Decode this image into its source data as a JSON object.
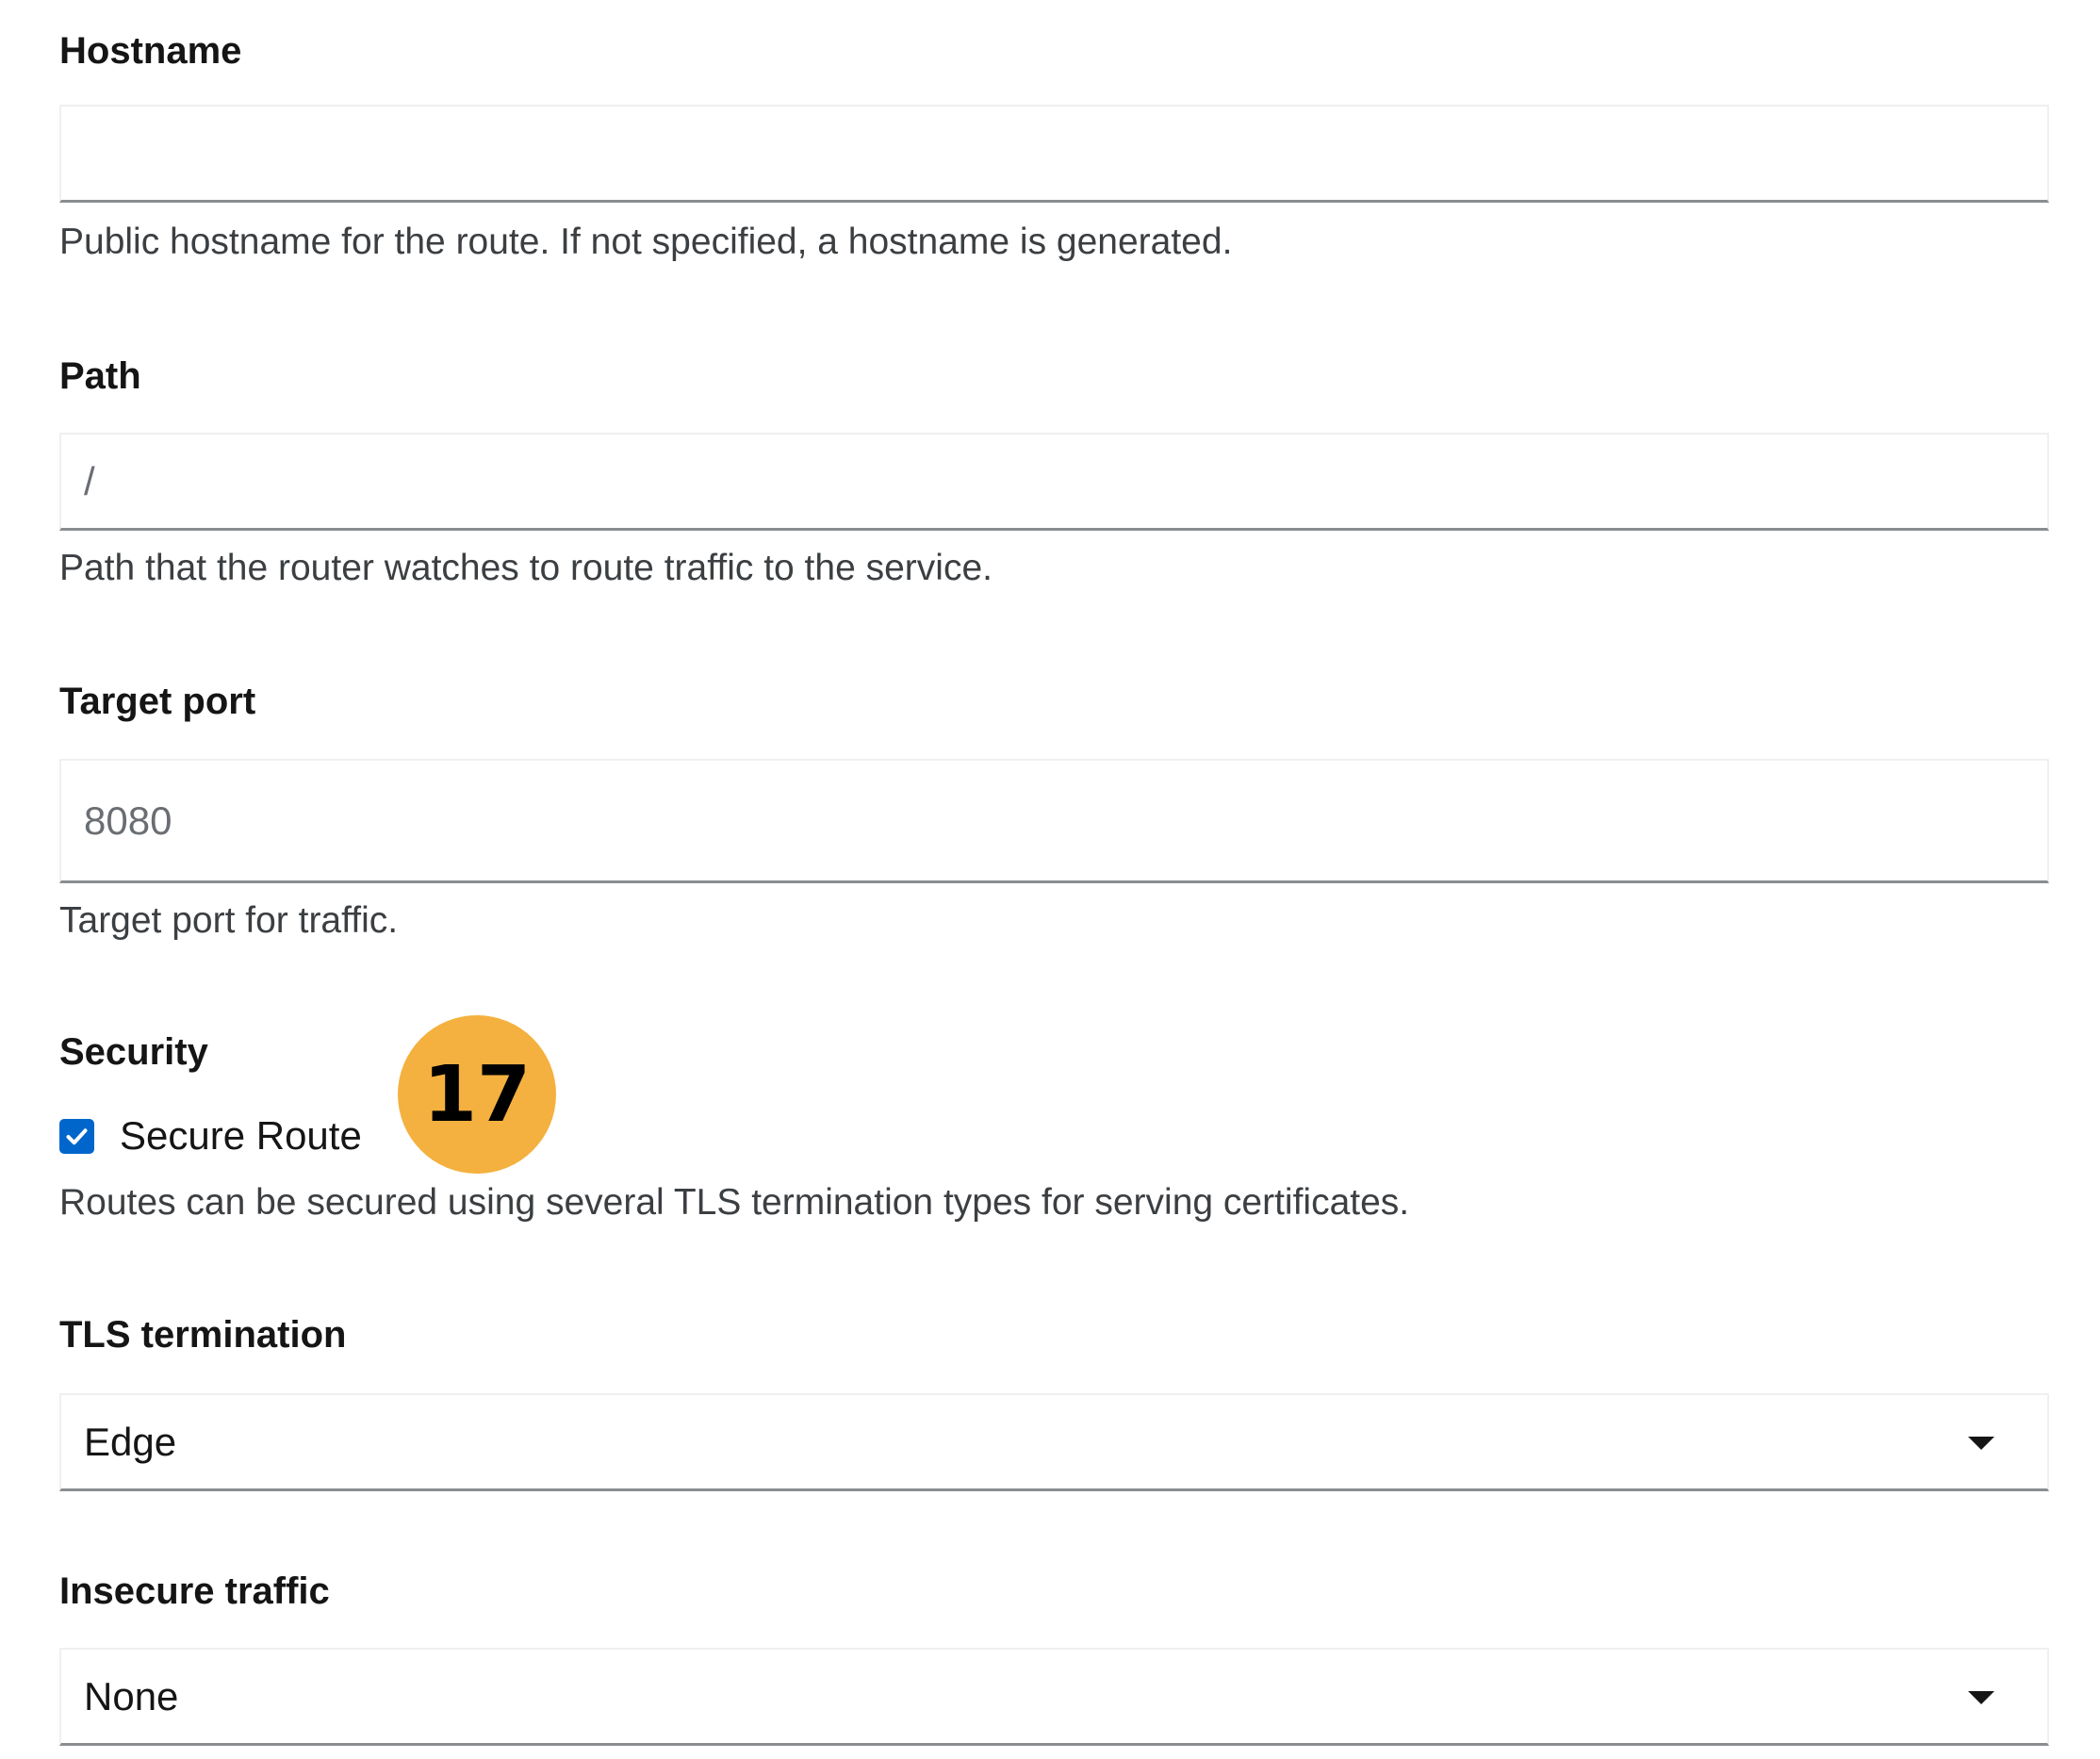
{
  "hostname": {
    "label": "Hostname",
    "value": "",
    "helper": "Public hostname for the route. If not specified, a hostname is generated."
  },
  "path": {
    "label": "Path",
    "placeholder": "/",
    "helper": "Path that the router watches to route traffic to the service."
  },
  "target_port": {
    "label": "Target port",
    "placeholder": "8080",
    "helper": "Target port for traffic."
  },
  "security": {
    "label": "Security",
    "checkbox_label": "Secure Route",
    "checked": true,
    "helper": "Routes can be secured using several TLS termination types for serving certificates."
  },
  "annotation_badge": "17",
  "tls_termination": {
    "label": "TLS termination",
    "selected": "Edge"
  },
  "insecure_traffic": {
    "label": "Insecure traffic",
    "selected": "None"
  },
  "colors": {
    "checkbox_accent": "#0066cc",
    "badge_fill": "#f4b13f",
    "field_underline": "#8a8d90"
  }
}
